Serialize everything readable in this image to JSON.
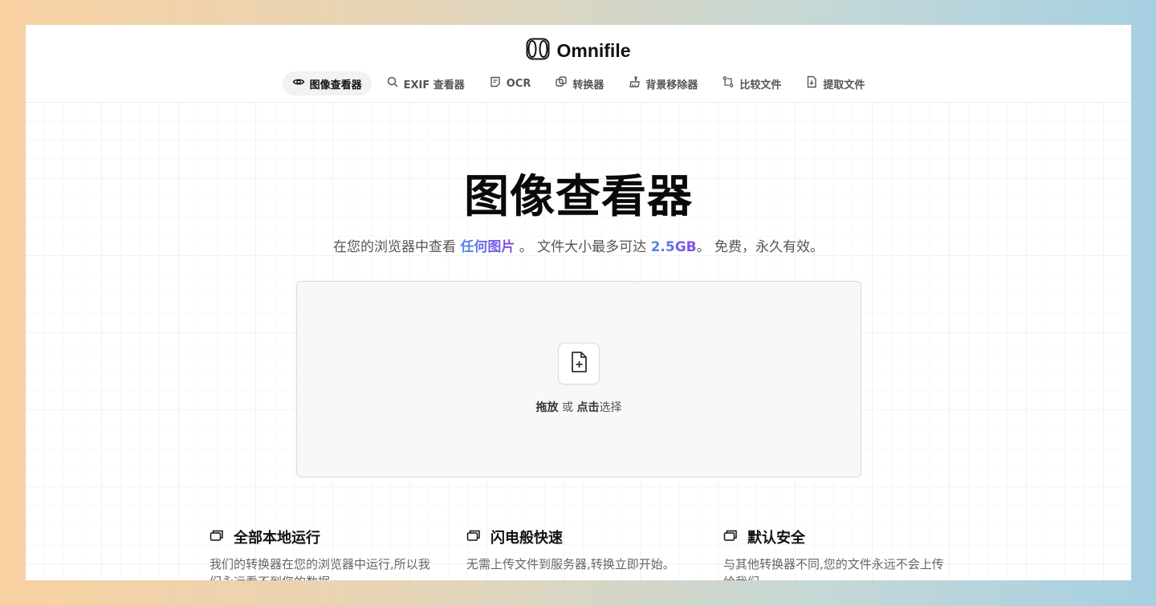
{
  "app": {
    "brand": "Omnifile",
    "logo_icon": "omnifile-logo-icon"
  },
  "nav": {
    "items": [
      {
        "label": "图像查看器",
        "icon": "eye-icon",
        "active": true
      },
      {
        "label": "EXIF 查看器",
        "icon": "search-icon",
        "active": false
      },
      {
        "label": "OCR",
        "icon": "ocr-icon",
        "active": false
      },
      {
        "label": "转换器",
        "icon": "convert-icon",
        "active": false
      },
      {
        "label": "背景移除器",
        "icon": "brush-icon",
        "active": false
      },
      {
        "label": "比较文件",
        "icon": "compare-icon",
        "active": false
      },
      {
        "label": "提取文件",
        "icon": "extract-file-icon",
        "active": false
      }
    ]
  },
  "hero": {
    "title": "图像查看器",
    "subtitle_pre": "在您的浏览器中查看 ",
    "subtitle_highlight1": "任何图片",
    "subtitle_mid": " 。 文件大小最多可达 ",
    "subtitle_highlight2": "2.5GB",
    "subtitle_post": "。 免费，永久有效。"
  },
  "dropzone": {
    "icon": "file-plus-icon",
    "drag_label": "拖放",
    "or_label": " 或 ",
    "click_label": "点击",
    "select_label": "选择"
  },
  "features": [
    {
      "title": "全部本地运行",
      "icon": "window-stack-icon",
      "desc": "我们的转换器在您的浏览器中运行,所以我们永远看不到您的数据。"
    },
    {
      "title": "闪电般快速",
      "icon": "window-stack-icon",
      "desc": "无需上传文件到服务器,转换立即开始。"
    },
    {
      "title": "默认安全",
      "icon": "window-stack-icon",
      "desc": "与其他转换器不同,您的文件永远不会上传给我们。"
    }
  ],
  "colors": {
    "highlight_start": "#4f8ce8",
    "highlight_end": "#8b46e6"
  }
}
